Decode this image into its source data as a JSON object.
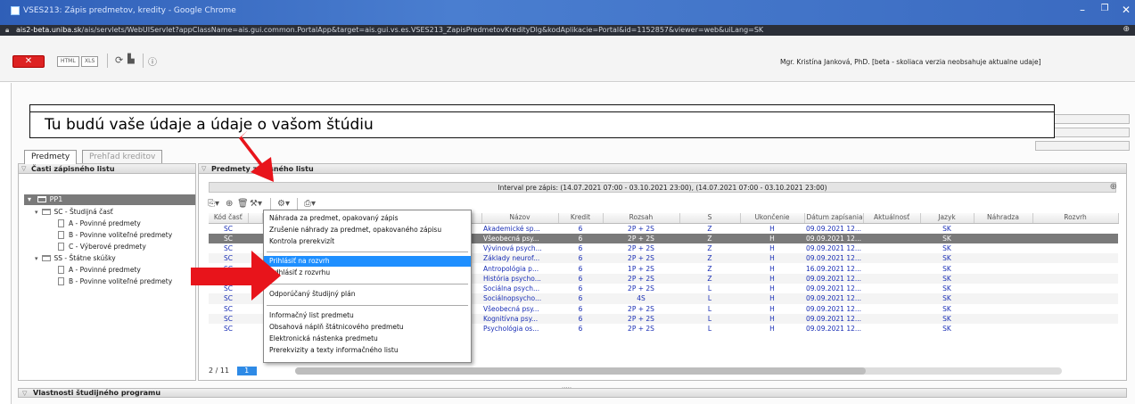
{
  "window": {
    "title": "VSES213: Zápis predmetov, kredity - Google Chrome",
    "controls": [
      "–",
      "❐",
      "✕"
    ]
  },
  "address": {
    "host": "ais2-beta.uniba.sk",
    "path": "/ais/servlets/WebUIServlet?appClassName=ais.gui.common.PortalApp&target=ais.gui.vs.es.VSES213_ZapisPredmetovKredityDlg&kodAplikacie=Portal&id=1152857&viewer=web&uiLang=SK"
  },
  "toolbar": {
    "close_label": "✕",
    "html_label": "HTML",
    "xls_label": "XLS",
    "user_info": "Mgr. Kristína Janková, PhD. [beta - skoliaca verzia neobsahuje aktualne udaje]"
  },
  "callout": {
    "text": "Tu budú vaše údaje a údaje o vašom štúdiu"
  },
  "tabs": [
    {
      "label": "Predmety",
      "active": true
    },
    {
      "label": "Prehľad kreditov",
      "active": false
    }
  ],
  "left_panel": {
    "header": "Časti zápisného listu",
    "root": "PP1",
    "nodes": [
      {
        "label": "SC - Študijná časť",
        "level": 1,
        "type": "folder"
      },
      {
        "label": "A - Povinné predmety",
        "level": 2,
        "type": "doc"
      },
      {
        "label": "B - Povinne voliteľné predmety",
        "level": 2,
        "type": "doc"
      },
      {
        "label": "C - Výberové predmety",
        "level": 2,
        "type": "doc"
      },
      {
        "label": "SS - Štátne skúšky",
        "level": 1,
        "type": "folder"
      },
      {
        "label": "A - Povinné predmety",
        "level": 2,
        "type": "doc"
      },
      {
        "label": "B - Povinne voliteľné predmety",
        "level": 2,
        "type": "doc"
      }
    ]
  },
  "right_panel": {
    "header": "Predmety zápisného listu",
    "interval": "Interval pre zápis: (14.07.2021 07:00 - 03.10.2021 23:00), (14.07.2021 07:00 - 03.10.2021 23:00)",
    "columns": [
      "Kód časť",
      "",
      "",
      "",
      "",
      "Názov",
      "Kredit",
      "Rozsah",
      "S",
      "Ukončenie",
      "Dátum zapísania",
      "Aktuálnosť",
      "Jazyk",
      "Náhradza",
      "Rozvrh"
    ],
    "rows": [
      {
        "part": "SC",
        "name": "Akademické sp...",
        "credit": "6",
        "range": "2P + 2S",
        "s": "Z",
        "end": "H",
        "date": "09.09.2021 12...",
        "lang": "SK"
      },
      {
        "part": "SC",
        "name": "Všeobecná psy...",
        "credit": "6",
        "range": "2P + 2S",
        "s": "Z",
        "end": "H",
        "date": "09.09.2021 12...",
        "lang": "SK"
      },
      {
        "part": "SC",
        "name": "Vývinová psych...",
        "credit": "6",
        "range": "2P + 2S",
        "s": "Z",
        "end": "H",
        "date": "09.09.2021 12...",
        "lang": "SK"
      },
      {
        "part": "SC",
        "name": "Základy neurof...",
        "credit": "6",
        "range": "2P + 2S",
        "s": "Z",
        "end": "H",
        "date": "09.09.2021 12...",
        "lang": "SK"
      },
      {
        "part": "SC",
        "name": "Antropológia p...",
        "credit": "6",
        "range": "1P + 2S",
        "s": "Z",
        "end": "H",
        "date": "16.09.2021 12...",
        "lang": "SK"
      },
      {
        "part": "SC",
        "name": "História psycho...",
        "credit": "6",
        "range": "2P + 2S",
        "s": "Z",
        "end": "H",
        "date": "09.09.2021 12...",
        "lang": "SK"
      },
      {
        "part": "SC",
        "name": "Sociálna psych...",
        "credit": "6",
        "range": "2P + 2S",
        "s": "L",
        "end": "H",
        "date": "09.09.2021 12...",
        "lang": "SK"
      },
      {
        "part": "SC",
        "name": "Sociálnopsycho...",
        "credit": "6",
        "range": "4S",
        "s": "L",
        "end": "H",
        "date": "09.09.2021 12...",
        "lang": "SK"
      },
      {
        "part": "SC",
        "name": "Všeobecná psy...",
        "credit": "6",
        "range": "2P + 2S",
        "s": "L",
        "end": "H",
        "date": "09.09.2021 12...",
        "lang": "SK"
      },
      {
        "part": "SC",
        "name": "Kognitívna psy...",
        "credit": "6",
        "range": "2P + 2S",
        "s": "L",
        "end": "H",
        "date": "09.09.2021 12...",
        "lang": "SK"
      },
      {
        "part": "SC",
        "name": "Psychológia os...",
        "credit": "6",
        "range": "2P + 2S",
        "s": "L",
        "end": "H",
        "date": "09.09.2021 12...",
        "lang": "SK"
      }
    ],
    "pager": {
      "current": "2",
      "separator": "/",
      "total": "11",
      "page_button": "1"
    }
  },
  "context_menu": {
    "groups": [
      [
        "Náhrada za predmet, opakovaný zápis",
        "Zrušenie náhrady za predmet, opakovaného zápisu",
        "Kontrola prerekvizít"
      ],
      [
        "Prihlásiť na rozvrh",
        "Odhlásiť z rozvrhu"
      ],
      [
        "Odporúčaný študijný plán"
      ],
      [
        "Informačný list predmetu",
        "Obsahová náplň štátnicového predmetu",
        "Elektronická nástenka predmetu",
        "Prerekvizity a texty informačného listu"
      ]
    ],
    "highlighted": "Prihlásiť na rozvrh"
  },
  "bottom": {
    "header": "Vlastnosti študijného programu",
    "splitter": "....."
  },
  "colors": {
    "accent": "#1e8fff",
    "arrow": "#e8141b",
    "link_text": "#1a2fb5",
    "selection": "#7a7a7a"
  }
}
